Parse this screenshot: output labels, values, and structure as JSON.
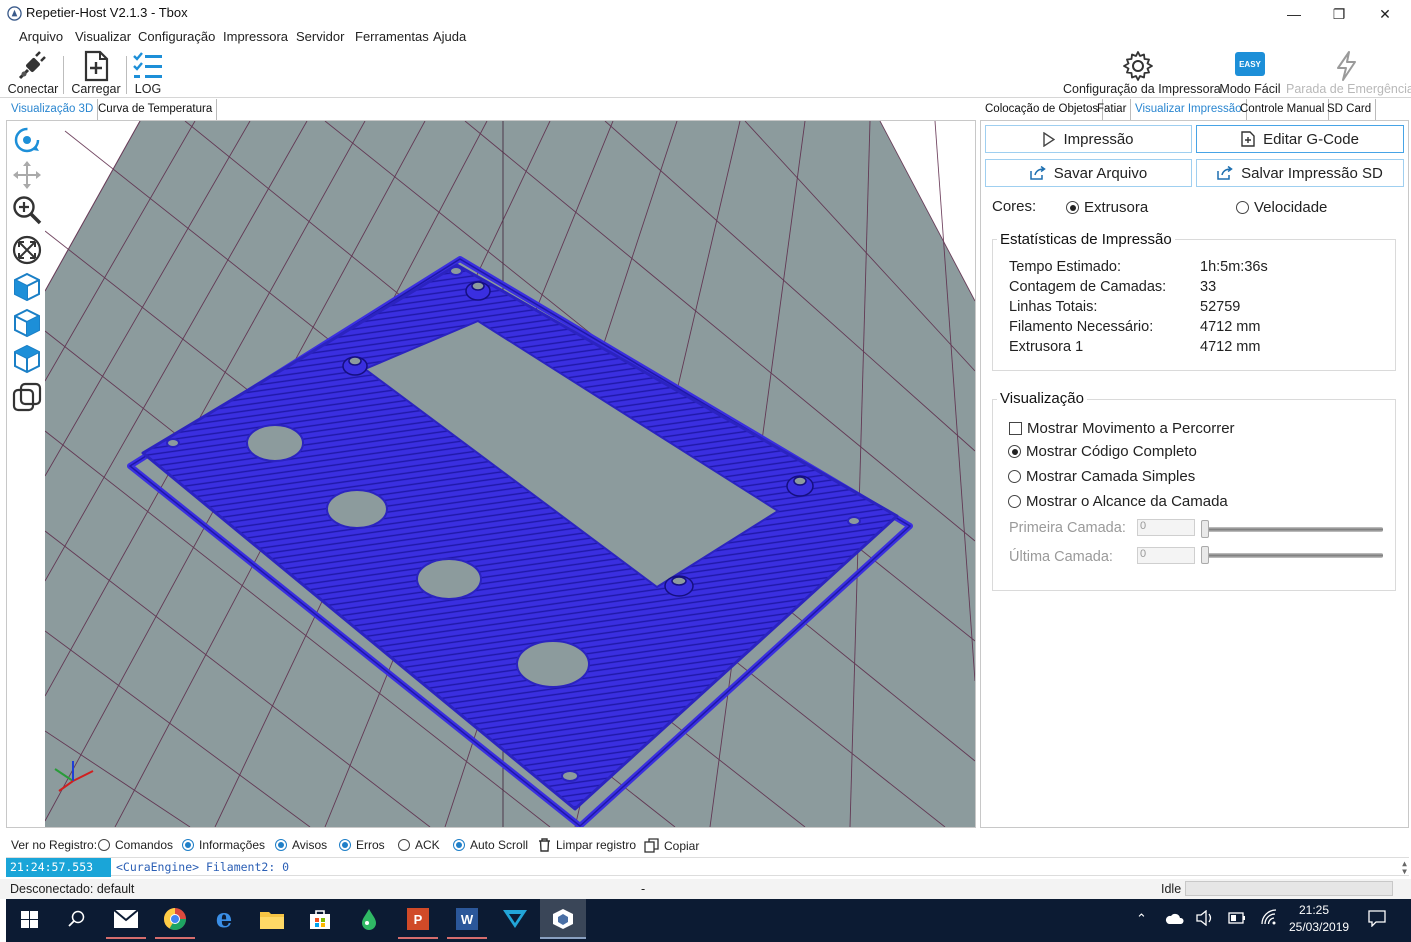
{
  "window": {
    "title": "Repetier-Host V2.1.3 - Tbox",
    "minimize": "—",
    "restore": "❐",
    "close": "✕"
  },
  "menu": [
    "Arquivo",
    "Visualizar",
    "Configuração",
    "Impressora",
    "Servidor",
    "Ferramentas",
    "Ajuda"
  ],
  "toolbar": {
    "connect": "Conectar",
    "load": "Carregar",
    "log": "LOG",
    "printer_settings": "Configuração da Impressora",
    "easy_mode": "Modo Fácil",
    "easy_badge": "EASY",
    "emergency_stop": "Parada de Emergência"
  },
  "left_tabs": [
    "Visualização 3D",
    "Curva de Temperatura"
  ],
  "right_tabs": [
    "Colocação de Objetos",
    "Fatiar",
    "Visualizar Impressão",
    "Controle Manual",
    "SD Card"
  ],
  "right_panel": {
    "btn_print": "Impressão",
    "btn_edit_gcode": "Editar G-Code",
    "btn_save_file": "Savar Arquivo",
    "btn_save_sd": "Salvar Impressão SD",
    "colors_label": "Cores:",
    "color_extruder": "Extrusora",
    "color_speed": "Velocidade",
    "stats_title": "Estatísticas de Impressão",
    "stats": [
      {
        "label": "Tempo Estimado:",
        "value": "1h:5m:36s"
      },
      {
        "label": "Contagem de Camadas:",
        "value": "33"
      },
      {
        "label": "Linhas Totais:",
        "value": "52759"
      },
      {
        "label": "Filamento Necessário:",
        "value": "4712 mm"
      },
      {
        "label": "Extrusora 1",
        "value": "4712 mm"
      }
    ],
    "viz_title": "Visualização",
    "viz_show_travel": "Mostrar Movimento a Percorrer",
    "viz_full_code": "Mostrar Código Completo",
    "viz_single_layer": "Mostrar Camada Simples",
    "viz_layer_range": "Mostrar o Alcance da Camada",
    "first_layer_label": "Primeira Camada:",
    "last_layer_label": "Última Camada:",
    "first_layer_value": "0",
    "last_layer_value": "0"
  },
  "log": {
    "show_label": "Ver no Registro:",
    "commands": "Comandos",
    "info": "Informações",
    "warnings": "Avisos",
    "errors": "Erros",
    "ack": "ACK",
    "autoscroll": "Auto Scroll",
    "clear": "Limpar registro",
    "copy": "Copiar",
    "time": "21:24:57.553",
    "message": "<CuraEngine> Filament2: 0"
  },
  "status": {
    "connection": "Desconectado: default",
    "middle": "-",
    "state": "Idle"
  },
  "taskbar": {
    "time": "21:25",
    "date": "25/03/2019"
  },
  "colors": {
    "accent": "#2a86d0",
    "print_blue": "#3a2fe0",
    "bed_gray": "#8c9b9d",
    "grid_line": "#5b2848"
  }
}
